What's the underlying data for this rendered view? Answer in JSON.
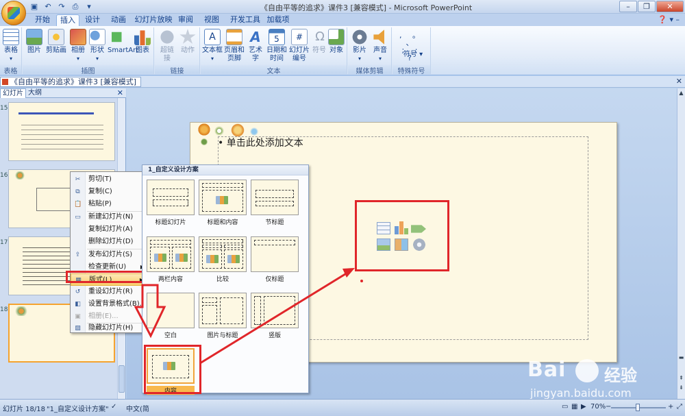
{
  "window": {
    "title": "《自由平等的追求》课件3 [兼容模式] - Microsoft PowerPoint"
  },
  "ribbon": {
    "tabs": [
      "开始",
      "插入",
      "设计",
      "动画",
      "幻灯片放映",
      "审阅",
      "视图",
      "开发工具",
      "加载项"
    ],
    "active_tab": "插入",
    "groups": [
      {
        "label": "表格",
        "buttons": [
          "表格"
        ]
      },
      {
        "label": "插图",
        "buttons": [
          "图片",
          "剪贴画",
          "相册",
          "形状",
          "SmartArt",
          "图表"
        ]
      },
      {
        "label": "链接",
        "buttons": [
          "超链接",
          "动作"
        ]
      },
      {
        "label": "文本",
        "buttons": [
          "文本框",
          "页眉和页脚",
          "艺术字",
          "日期和时间",
          "幻灯片编号",
          "符号",
          "对象"
        ]
      },
      {
        "label": "媒体剪辑",
        "buttons": [
          "影片",
          "声音"
        ]
      },
      {
        "label": "特殊符号",
        "buttons": [
          "符号"
        ]
      }
    ]
  },
  "document_tab": {
    "label": "《自由平等的追求》课件3 [兼容模式]"
  },
  "left_panel": {
    "tabs": [
      "幻灯片",
      "大纲"
    ],
    "slide_numbers": [
      "15",
      "16",
      "17",
      "18"
    ]
  },
  "slide": {
    "placeholder_text": "• 单击此处添加文本"
  },
  "context_menu": {
    "items": [
      {
        "label": "剪切(T)",
        "icon": "scissors-icon",
        "disabled": false
      },
      {
        "label": "复制(C)",
        "icon": "copy-icon",
        "disabled": false
      },
      {
        "label": "粘贴(P)",
        "icon": "paste-icon",
        "disabled": false
      },
      {
        "label": "新建幻灯片(N)",
        "icon": "new-slide-icon",
        "disabled": false
      },
      {
        "label": "复制幻灯片(A)",
        "icon": "",
        "disabled": false
      },
      {
        "label": "删除幻灯片(D)",
        "icon": "",
        "disabled": false
      },
      {
        "label": "发布幻灯片(S)",
        "icon": "publish-icon",
        "disabled": false
      },
      {
        "label": "检查更新(U)",
        "icon": "",
        "disabled": false
      },
      {
        "label": "版式(L)",
        "icon": "layout-icon",
        "disabled": false
      },
      {
        "label": "重设幻灯片(R)",
        "icon": "reset-icon",
        "disabled": false
      },
      {
        "label": "设置背景格式(B)...",
        "icon": "background-icon",
        "disabled": false
      },
      {
        "label": "相册(E)...",
        "icon": "album-icon",
        "disabled": true
      },
      {
        "label": "隐藏幻灯片(H)",
        "icon": "hide-slide-icon",
        "disabled": false
      }
    ],
    "highlighted": "版式(L)"
  },
  "layout_gallery": {
    "title": "1_自定义设计方案",
    "layouts": [
      "标题幻灯片",
      "标题和内容",
      "节标题",
      "两栏内容",
      "比较",
      "仅标题",
      "空白",
      "图片与标题",
      "竖版",
      "内容"
    ],
    "selected": "内容"
  },
  "watermark": {
    "brand": "Bai",
    "brand_cn": "经验",
    "url": "jingyan.baidu.com"
  },
  "status_bar": {
    "slide_info": "幻灯片 18/18",
    "theme": "\"1_自定义设计方案\"",
    "language": "中文(简",
    "zoom": "70%"
  },
  "colors": {
    "annotation_red": "#e0262a",
    "accent_orange": "#f5a32f"
  }
}
